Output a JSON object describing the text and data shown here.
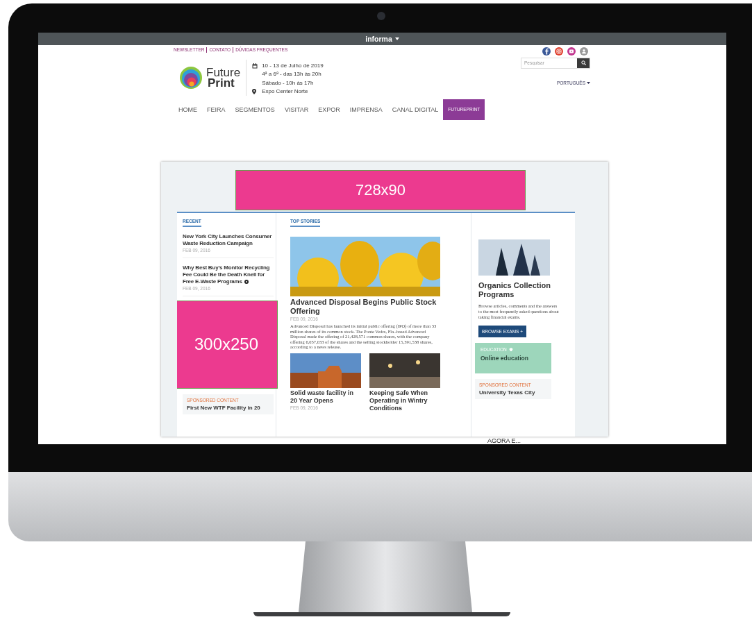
{
  "topbar": {
    "brand": "informa"
  },
  "header": {
    "links": [
      "NEWSLETTER",
      "CONTATO",
      "DÚVIDAS FREQUENTES"
    ],
    "social": [
      {
        "kind": "letter-f",
        "color": "#3b5998"
      },
      {
        "kind": "camera",
        "color": "#e0412f"
      },
      {
        "kind": "play",
        "color": "#c2368f"
      },
      {
        "kind": "person",
        "color": "#9a9a9a"
      }
    ],
    "logo": {
      "line1": "Future",
      "line2": "Print"
    },
    "event": {
      "dates": "10 - 13 de Julho de 2019",
      "weekdays": "4ª a 6ª - das 13h às 20h",
      "saturday": "Sábado - 10h às 17h",
      "venue": "Expo Center Norte"
    },
    "search": {
      "placeholder": "Pesquisar"
    },
    "language": "PORTUGUÊS"
  },
  "nav": [
    {
      "label": "HOME",
      "selected": false
    },
    {
      "label": "FEIRA",
      "selected": false
    },
    {
      "label": "SEGMENTOS",
      "selected": false
    },
    {
      "label": "VISITAR",
      "selected": false
    },
    {
      "label": "EXPOR",
      "selected": false
    },
    {
      "label": "IMPRENSA",
      "selected": false
    },
    {
      "label": "CANAL DIGITAL",
      "selected": false
    },
    {
      "label": "FUTUREPRINT",
      "selected": true
    }
  ],
  "mockup": {
    "ad_top": "728x90",
    "recent": {
      "heading": "RECENT",
      "items": [
        {
          "title": "New York City Launches Consumer Waste Reduction Campaign",
          "date": "FEB 09, 2016",
          "marked": false
        },
        {
          "title": "Why Best Buy's Monitor Recycling Fee Could Be the Death Knell for Free E-Waste Programs",
          "date": "FEB 09, 2016",
          "marked": true
        }
      ]
    },
    "ad_side": "300x250",
    "sponsored_left": {
      "label": "SPONSORED CONTENT",
      "title": "First New WTF Facility in 20"
    },
    "top_stories": {
      "heading": "TOP STORIES",
      "lead": {
        "title": "Advanced Disposal Begins Public Stock Offering",
        "date": "FEB 09, 2016",
        "summary": "Advanced Disposal has launched its initial public offering (IPO) of more than 33 million shares of its common stock. The Ponte Vedra, Fla.-based Advanced Disposal made the offering of 21,428,571 common shares, with the company offering 6,037,033 of the shares and the selling stockholder 15,391,538 shares, according to a news release."
      },
      "stories": [
        {
          "title": "Solid waste facility in 20 Year Opens",
          "date": "FEB 09, 2016"
        },
        {
          "title": "Keeping Safe When Operating in Wintry Conditions"
        }
      ]
    },
    "feature": {
      "title": "Organics Collection Programs",
      "text": "Browse articles, comments and the answers to the most frequently asked questions about taking financial exams.",
      "button": "BROWSE EXAMS +"
    },
    "promo": {
      "label": "EDUCATION",
      "title": "Online education"
    },
    "sponsored_right": {
      "label": "SPONSORED CONTENT",
      "title": "University Texas City"
    }
  },
  "caption": "AGORA E..."
}
